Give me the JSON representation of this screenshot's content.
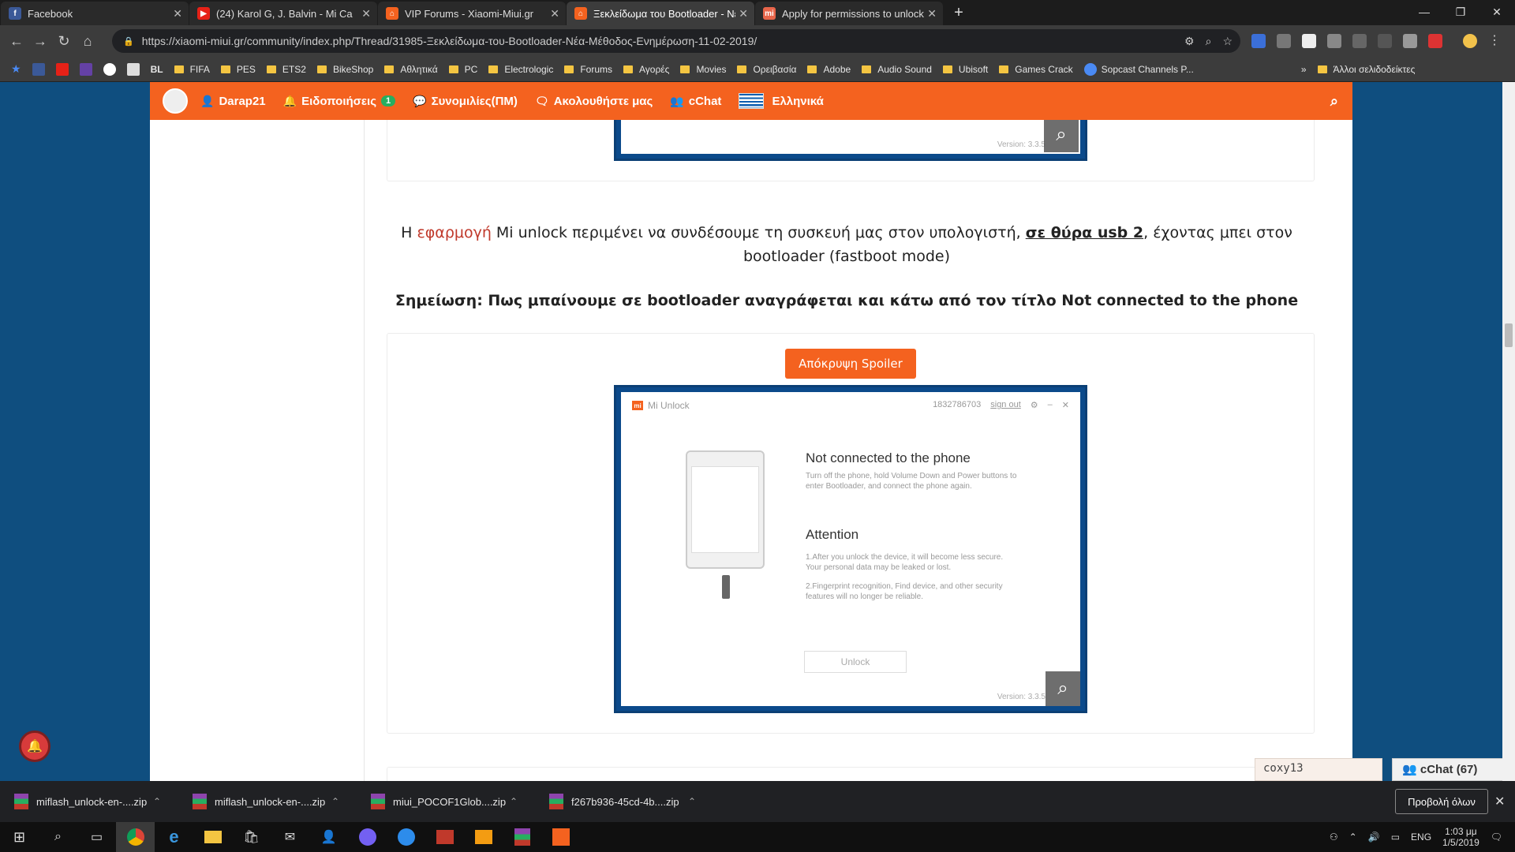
{
  "browser": {
    "tabs": [
      {
        "title": "Facebook",
        "color": "#3b5998",
        "glyph": "f"
      },
      {
        "title": "(24) Karol G, J. Balvin - Mi Ca",
        "color": "#e62117",
        "glyph": "▶"
      },
      {
        "title": "VIP Forums - Xiaomi-Miui.gr",
        "color": "#f4621f",
        "glyph": "⌂"
      },
      {
        "title": "Ξεκλείδωμα του Bootloader - Νέ",
        "color": "#f4621f",
        "glyph": "⌂"
      },
      {
        "title": "Apply for permissions to unlock",
        "color": "#e8654a",
        "glyph": "mi"
      }
    ],
    "url": "https://xiaomi-miui.gr/community/index.php/Thread/31985-Ξεκλείδωμα-του-Bootloader-Νέα-Μέθοδος-Ενημέρωση-11-02-2019/",
    "bookmarks": [
      "FIFA",
      "PES",
      "ETS2",
      "BikeShop",
      "Αθλητικά",
      "PC",
      "Electrologic",
      "Forums",
      "Αγορές",
      "Movies",
      "Ορειβασία",
      "Adobe",
      "Audio Sound",
      "Ubisoft",
      "Games Crack",
      "Sopcast Channels P..."
    ],
    "bookmark_bl": "BL",
    "other_bookmarks": "Άλλοι σελιδοδείκτες"
  },
  "site_nav": {
    "user": "Darap21",
    "notifications": "Ειδοποιήσεις",
    "notifications_count": "1",
    "conversations": "Συνομιλίες(ΠΜ)",
    "follow": "Ακολουθήστε μας",
    "chat": "cChat",
    "language": "Ελληνικά"
  },
  "content": {
    "para_prefix": "Η ",
    "para_red": "εφαρμογή",
    "para_mid": " Mi unlock περιμένει να συνδέσουμε τη συσκευή μας στον υπολογιστή, ",
    "para_link": "σε θύρα usb 2",
    "para_suffix": ", έχοντας μπει στον bootloader (fastboot mode)",
    "note": "Σημείωση: Πως μπαίνουμε σε bootloader αναγράφεται και κάτω από τον τίτλο Not connected to the phone",
    "spoiler_button": "Απόκρυψη Spoiler"
  },
  "mi_unlock": {
    "app_title": "Mi Unlock",
    "account_id": "1832786703",
    "sign_out": "sign out",
    "heading1": "Not connected to the phone",
    "text1": "Turn off the phone, hold Volume Down and Power buttons to enter Bootloader, and connect the phone again.",
    "heading2": "Attention",
    "text2": "1.After you unlock the device, it will become less secure. Your personal data may be leaked or lost.",
    "text3": "2.Fingerprint recognition, Find device, and other security features will no longer be reliable.",
    "unlock_button": "Unlock",
    "version": "Version: 3.3.5"
  },
  "chat": {
    "user": "coxy13",
    "tab_label": "cChat (67)"
  },
  "downloads": {
    "items": [
      "miflash_unlock-en-....zip",
      "miflash_unlock-en-....zip",
      "miui_POCOF1Glob....zip",
      "f267b936-45cd-4b....zip"
    ],
    "show_all": "Προβολή όλων"
  },
  "taskbar": {
    "lang": "ENG",
    "time": "1:03 μμ",
    "date": "1/5/2019"
  }
}
